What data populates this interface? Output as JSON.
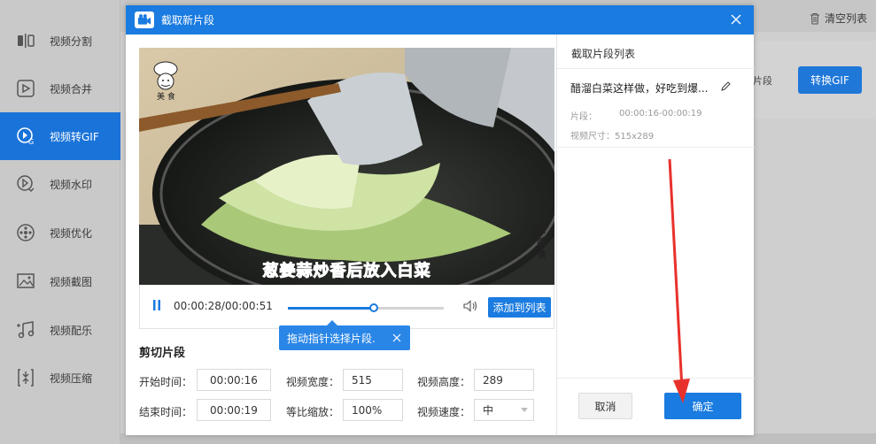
{
  "sidebar": {
    "items": [
      {
        "label": "视频分割",
        "icon": "split-icon",
        "active": false
      },
      {
        "label": "视频合并",
        "icon": "merge-icon",
        "active": false
      },
      {
        "label": "视频转GIF",
        "icon": "gif-icon",
        "active": true
      },
      {
        "label": "视频水印",
        "icon": "watermark-icon",
        "active": false
      },
      {
        "label": "视频优化",
        "icon": "optimize-icon",
        "active": false
      },
      {
        "label": "视频截图",
        "icon": "screenshot-icon",
        "active": false
      },
      {
        "label": "视频配乐",
        "icon": "music-icon",
        "active": false
      },
      {
        "label": "视频压缩",
        "icon": "compress-icon",
        "active": false
      }
    ]
  },
  "background": {
    "clear_list": "清空列表",
    "frag_label": "片段",
    "convert_button": "转换GIF"
  },
  "dialog": {
    "title": "截取新片段",
    "video": {
      "subtitle": "葱姜蒜炒香后放入白菜",
      "watermark_vertical": "小房美食",
      "chef_text": "美 食"
    },
    "player": {
      "time": "00:00:28/00:00:51",
      "progress_fraction": 0.55,
      "marker_start_fraction": 0.29,
      "marker_end_fraction": 0.37,
      "add_button": "添加到列表"
    },
    "tooltip": "拖动指针选择片段.",
    "cut": {
      "title": "剪切片段",
      "start_label": "开始时间：",
      "start_value": "00:00:16",
      "end_label": "结束时间：",
      "end_value": "00:00:19",
      "width_label": "视频宽度：",
      "width_value": "515",
      "height_label": "视频高度：",
      "height_value": "289",
      "scale_label": "等比缩放：",
      "scale_value": "100%",
      "speed_label": "视频速度：",
      "speed_value": "中"
    },
    "list": {
      "title": "截取片段列表",
      "item_name": "醋溜白菜这样做，好吃到爆...",
      "seg_label": "片段：",
      "seg_value": "00:00:16-00:00:19",
      "size_text": "视频尺寸：515x289"
    },
    "buttons": {
      "cancel": "取消",
      "confirm": "确定"
    }
  },
  "colors": {
    "accent": "#1a7be0",
    "annotation_arrow": "#e8312b"
  }
}
